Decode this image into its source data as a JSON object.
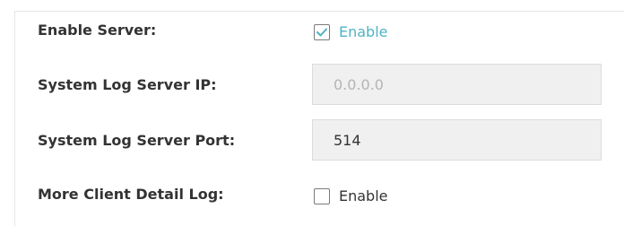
{
  "fields": {
    "enable_server": {
      "label": "Enable Server:",
      "checked": true,
      "checkbox_text": "Enable"
    },
    "server_ip": {
      "label": "System Log Server IP:",
      "value": "0.0.0.0",
      "disabled": true
    },
    "server_port": {
      "label": "System Log Server Port:",
      "value": "514",
      "disabled": false
    },
    "client_detail_log": {
      "label": "More Client Detail Log:",
      "checked": false,
      "checkbox_text": "Enable"
    }
  },
  "colors": {
    "label_text": "#333333",
    "accent": "#4fb3c1",
    "field_bg": "#f0f0f0",
    "field_border": "#dcdcdc",
    "disabled_text": "#b4b4b4"
  },
  "icons": {
    "enable_server_check": "checkmark-icon"
  }
}
